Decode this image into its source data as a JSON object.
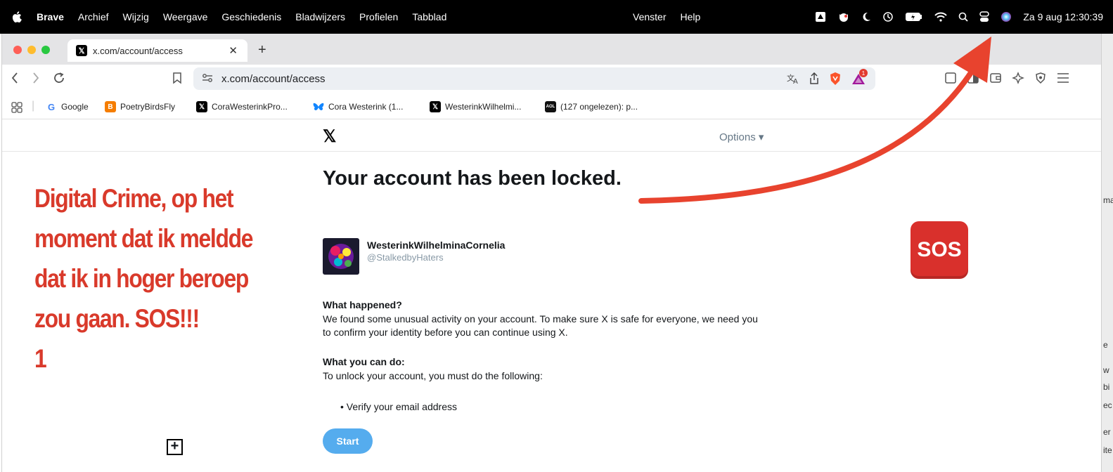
{
  "menubar": {
    "app_name": "Brave",
    "menus": [
      "Archief",
      "Wijzig",
      "Weergave",
      "Geschiedenis",
      "Bladwijzers",
      "Profielen",
      "Tabblad"
    ],
    "right_menus": [
      "Venster",
      "Help"
    ],
    "clock": "Za 9 aug  12:30:39"
  },
  "tab": {
    "title": "x.com/account/access"
  },
  "urlbar": {
    "url": "x.com/account/access",
    "notification_badge": "1"
  },
  "bookmarks": [
    {
      "label": "Google",
      "icon": "google-icon"
    },
    {
      "label": "PoetryBirdsFly",
      "icon": "blogger-icon"
    },
    {
      "label": "CoraWesterinkPro...",
      "icon": "x-icon"
    },
    {
      "label": "Cora Westerink (1...",
      "icon": "bluesky-icon"
    },
    {
      "label": "WesterinkWilhelmi...",
      "icon": "x-icon"
    },
    {
      "label": "(127 ongelezen): p...",
      "icon": "aol-icon"
    }
  ],
  "x_header": {
    "logo": "𝕏",
    "options": "Options ▾"
  },
  "content": {
    "heading": "Your account has been locked.",
    "username": "WesterinkWilhelminaCornelia",
    "handle": "@StalkedbyHaters",
    "what_happened_title": "What happened?",
    "what_happened_text": "We found some unusual activity on your account. To make sure X is safe for everyone, we need you to confirm your identity before you can continue using X.",
    "what_you_can_do_title": "What you can do:",
    "what_you_can_do_text": "To unlock your account, you must do the following:",
    "bullet": "Verify your email address",
    "start_button": "Start"
  },
  "overlay": {
    "text": "Digital Crime, op het moment dat ik meldde dat ik in hoger beroep zou gaan. SOS!!!\n1",
    "sos_emoji_text": "SOS",
    "color": "#d93a2b"
  },
  "right_strip": [
    "ma",
    "e",
    "w",
    "bi",
    "ec",
    "er",
    "ite"
  ]
}
